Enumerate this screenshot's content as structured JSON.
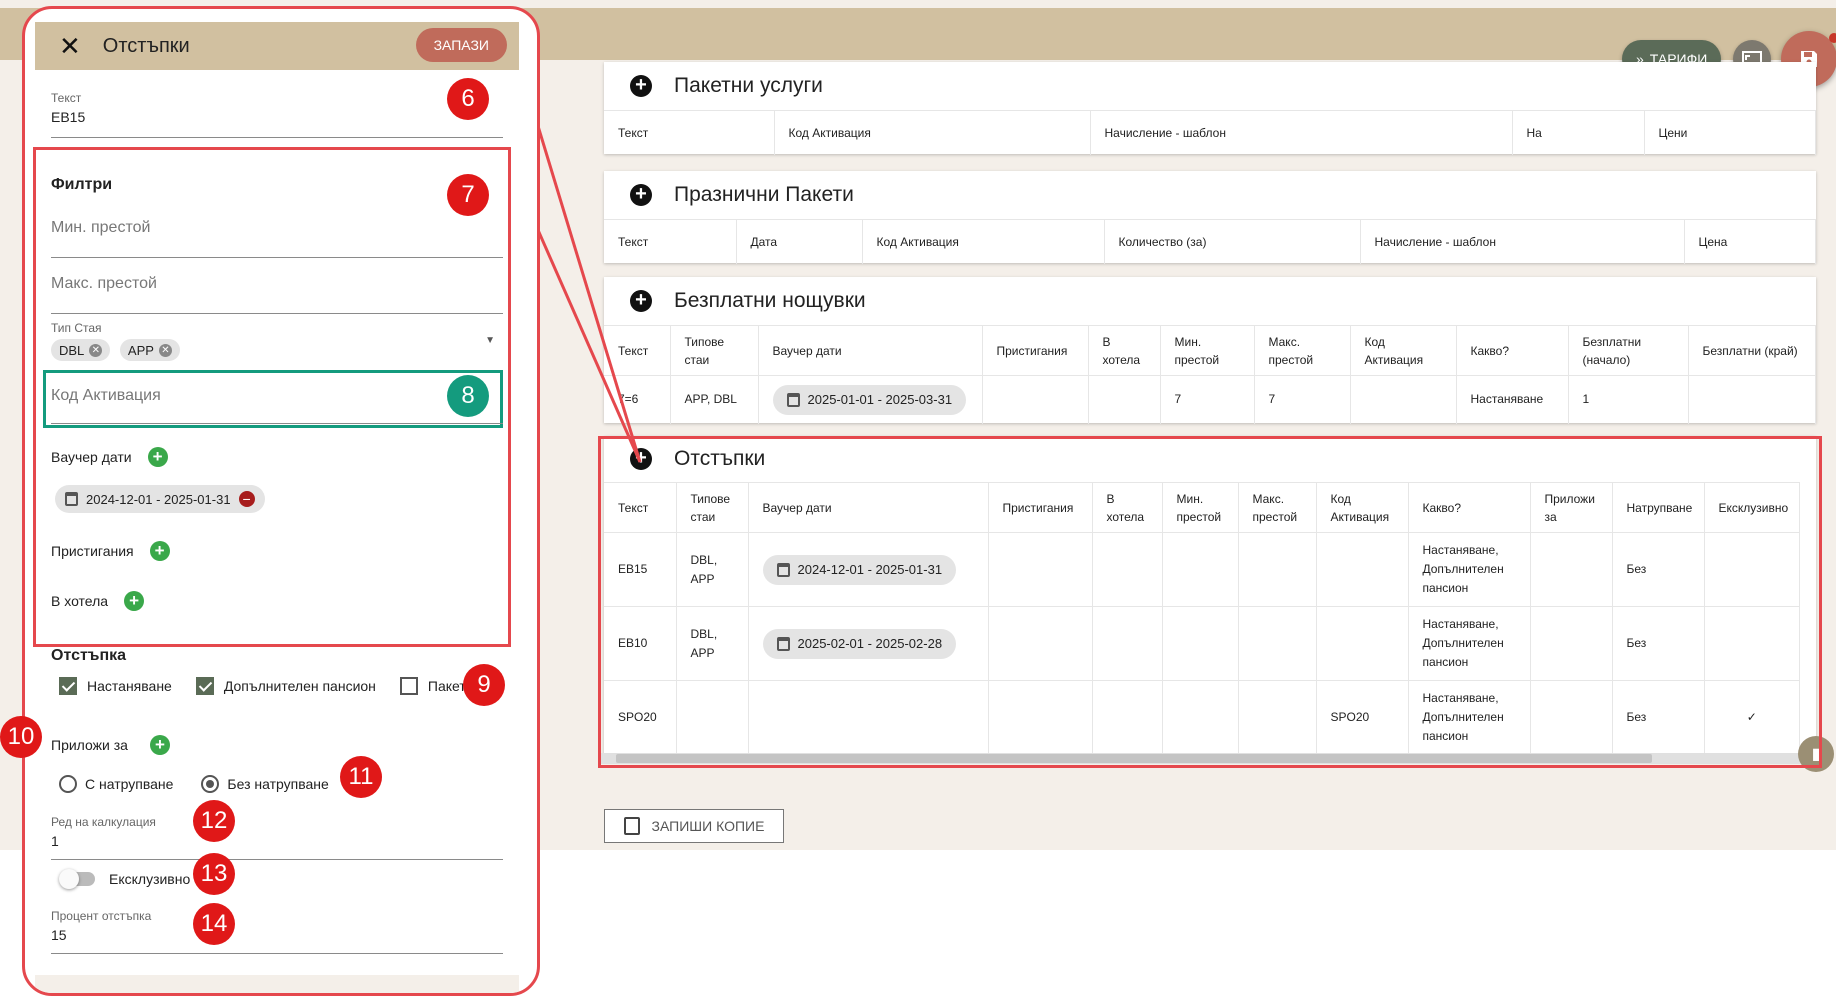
{
  "colors": {
    "accent_red": "#e5484d",
    "header_tan": "#d1c0a0",
    "save_brown": "#c06b5b",
    "badge_red": "#e01818",
    "badge_teal": "#149b7e",
    "green_plus": "#3aa84a"
  },
  "toolbar": {
    "tarifi_label": "ТАРИФИ",
    "tarifi_icon": "double-chevron-right-icon",
    "fullscreen_icon": "fullscreen-icon",
    "save_icon": "save-icon"
  },
  "cards": {
    "paketni": {
      "title": "Пакетни услуги",
      "columns": [
        "Текст",
        "Код Активация",
        "Начисление - шаблон",
        "На",
        "Цени"
      ]
    },
    "prazni": {
      "title": "Празнични Пакети",
      "columns": [
        "Текст",
        "Дата",
        "Код Активация",
        "Количество (за)",
        "Начисление - шаблон",
        "Цена"
      ]
    },
    "bezplatni": {
      "title": "Безплатни нощувки",
      "columns": [
        "Текст",
        "Типове стаи",
        "Ваучер дати",
        "Пристигания",
        "В хотела",
        "Мин. престой",
        "Макс. престой",
        "Код Активация",
        "Какво?",
        "Безплатни (начало)",
        "Безплатни (край)"
      ],
      "row": {
        "text": "7=6",
        "rooms": "APP, DBL",
        "dates": "2025-01-01 - 2025-03-31",
        "arrivals": "",
        "in_hotel": "",
        "min": "7",
        "max": "7",
        "code": "",
        "what": "Настаняване",
        "free_start": "1",
        "free_end": ""
      }
    },
    "otstapki": {
      "title": "Отстъпки",
      "columns": [
        "Текст",
        "Типове стаи",
        "Ваучер дати",
        "Пристигания",
        "В хотела",
        "Мин. престой",
        "Макс. престой",
        "Код Активация",
        "Какво?",
        "Приложи за",
        "Натрупване",
        "Ексклузивно"
      ],
      "rows": [
        {
          "text": "EB15",
          "rooms": "DBL, APP",
          "dates": "2024-12-01 - 2025-01-31",
          "code": "",
          "what": "Настаняване, Допълнителен пансион",
          "accum": "Без",
          "excl": ""
        },
        {
          "text": "EB10",
          "rooms": "DBL, APP",
          "dates": "2025-02-01 - 2025-02-28",
          "code": "",
          "what": "Настаняване, Допълнителен пансион",
          "accum": "Без",
          "excl": ""
        },
        {
          "text": "SPO20",
          "rooms": "",
          "dates": "",
          "code": "SPO20",
          "what": "Настаняване, Допълнителен пансион",
          "accum": "Без",
          "excl": "✓"
        }
      ]
    }
  },
  "copy_button": "ЗАПИШИ КОПИЕ",
  "panel": {
    "title": "Отстъпки",
    "save": "ЗАПАЗИ",
    "text_label": "Текст",
    "text_value": "EB15",
    "filters_title": "Филтри",
    "min_stay_ph": "Мин. престой",
    "max_stay_ph": "Макс. престой",
    "room_type_label": "Тип Стая",
    "room_chips": [
      "DBL",
      "APP"
    ],
    "code_ph": "Код Активация",
    "voucher_label": "Ваучер дати",
    "voucher_chip": "2024-12-01 - 2025-01-31",
    "arrivals_label": "Пристигания",
    "in_hotel_label": "В хотела",
    "discount_title": "Отстъпка",
    "cb_stay": "Настаняване",
    "cb_board": "Допълнителен пансион",
    "cb_package": "Пакет",
    "apply_label": "Приложи за",
    "radio_with": "С натрупване",
    "radio_without": "Без натрупване",
    "calc_label": "Ред на калкулация",
    "calc_value": "1",
    "exclusive_label": "Ексклузивно",
    "percent_label": "Процент отстъпка",
    "percent_value": "15"
  },
  "badges": [
    "6",
    "7",
    "8",
    "9",
    "10",
    "11",
    "12",
    "13",
    "14"
  ]
}
